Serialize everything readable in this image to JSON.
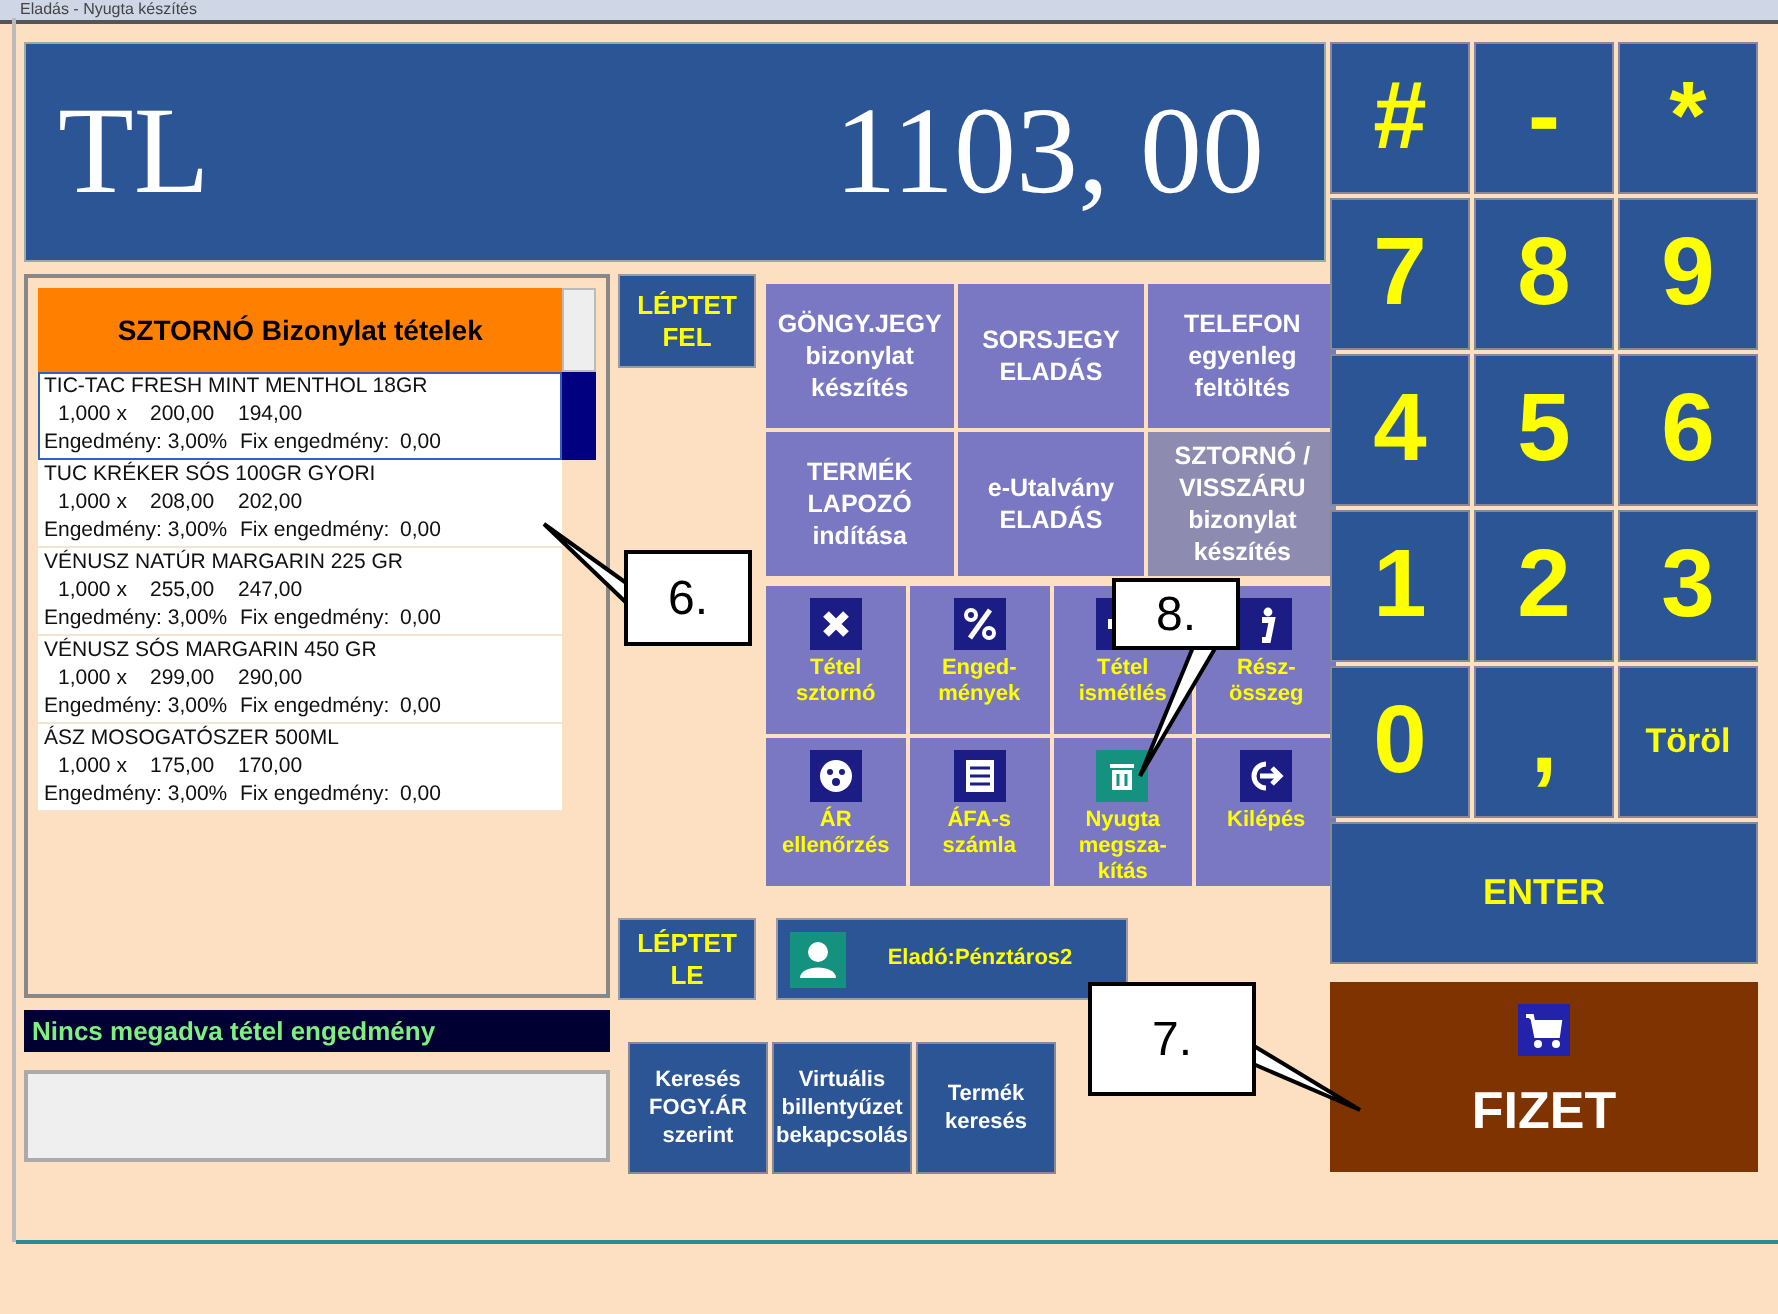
{
  "window": {
    "title": "Eladás - Nyugta készítés"
  },
  "display": {
    "currency": "TL",
    "amount": "1103, 00"
  },
  "receipt_list": {
    "title": "SZTORNÓ Bizonylat tételek",
    "items": [
      {
        "name": "TIC-TAC FRESH MINT MENTHOL 18GR",
        "quantity": "1,000 x",
        "unit_price": "200,00",
        "total": "194,00",
        "discount": "Engedmény: 3,00%",
        "fixed_discount_label": "Fix engedmény:",
        "fixed_discount": "0,00",
        "selected": true
      },
      {
        "name": "TUC KRÉKER SÓS 100GR GYORI",
        "quantity": "1,000 x",
        "unit_price": "208,00",
        "total": "202,00",
        "discount": "Engedmény: 3,00%",
        "fixed_discount_label": "Fix engedmény:",
        "fixed_discount": "0,00",
        "selected": false
      },
      {
        "name": "VÉNUSZ NATÚR MARGARIN 225 GR",
        "quantity": "1,000 x",
        "unit_price": "255,00",
        "total": "247,00",
        "discount": "Engedmény: 3,00%",
        "fixed_discount_label": "Fix engedmény:",
        "fixed_discount": "0,00",
        "selected": false
      },
      {
        "name": "VÉNUSZ SÓS MARGARIN 450 GR",
        "quantity": "1,000 x",
        "unit_price": "299,00",
        "total": "290,00",
        "discount": "Engedmény: 3,00%",
        "fixed_discount_label": "Fix engedmény:",
        "fixed_discount": "0,00",
        "selected": false
      },
      {
        "name": "ÁSZ MOSOGATÓSZER 500ML",
        "quantity": "1,000 x",
        "unit_price": "175,00",
        "total": "170,00",
        "discount": "Engedmény: 3,00%",
        "fixed_discount_label": "Fix engedmény:",
        "fixed_discount": "0,00",
        "selected": false
      }
    ]
  },
  "info_bar": "Nincs megadva tétel engedmény",
  "step_up": "LÉPTET\nFEL",
  "step_down": "LÉPTET\nLE",
  "seller": "Eladó:Pénztáros2",
  "function_buttons": [
    {
      "kind": "text",
      "label": "GÖNGY.JEGY\nbizonylat\nkészítés",
      "disabled": false
    },
    {
      "kind": "text",
      "label": "SORSJEGY\nELADÁS",
      "disabled": false
    },
    {
      "kind": "text",
      "label": "TELEFON\negyenleg\nfeltöltés",
      "disabled": false
    },
    {
      "kind": "text",
      "label": "TERMÉK\nLAPOZÓ\nindítása",
      "disabled": false
    },
    {
      "kind": "text",
      "label": "e-Utalvány\nELADÁS",
      "disabled": false
    },
    {
      "kind": "text",
      "label": "SZTORNÓ /\nVISSZÁRU\nbizonylat\nkészítés",
      "disabled": true
    },
    {
      "kind": "icon",
      "label": "Tétel\nsztornó"
    },
    {
      "kind": "icon",
      "label": "Enged-\nmények"
    },
    {
      "kind": "icon",
      "label": "Tétel\nismétlés"
    },
    {
      "kind": "icon",
      "label": "Rész-\nösszeg"
    },
    {
      "kind": "icon",
      "label": "ÁR\nellenőrzés"
    },
    {
      "kind": "icon",
      "label": "ÁFA-s\nszámla"
    },
    {
      "kind": "icon",
      "label": "Nyugta\nmegsza-\nkítás"
    },
    {
      "kind": "icon",
      "label": "Kilépés"
    }
  ],
  "bottom_buttons": [
    "Keresés\nFOGY.ÁR\nszerint",
    "Virtuális\nbillentyűzet\nbekapcsolás",
    "Termék\nkeresés"
  ],
  "keypad": [
    "#",
    "-",
    "*",
    "7",
    "8",
    "9",
    "4",
    "5",
    "6",
    "1",
    "2",
    "3",
    "0",
    ",",
    "Töröl"
  ],
  "enter": "ENTER",
  "pay": "FIZET",
  "callouts": [
    {
      "label": "6."
    },
    {
      "label": "7."
    },
    {
      "label": "8."
    }
  ]
}
